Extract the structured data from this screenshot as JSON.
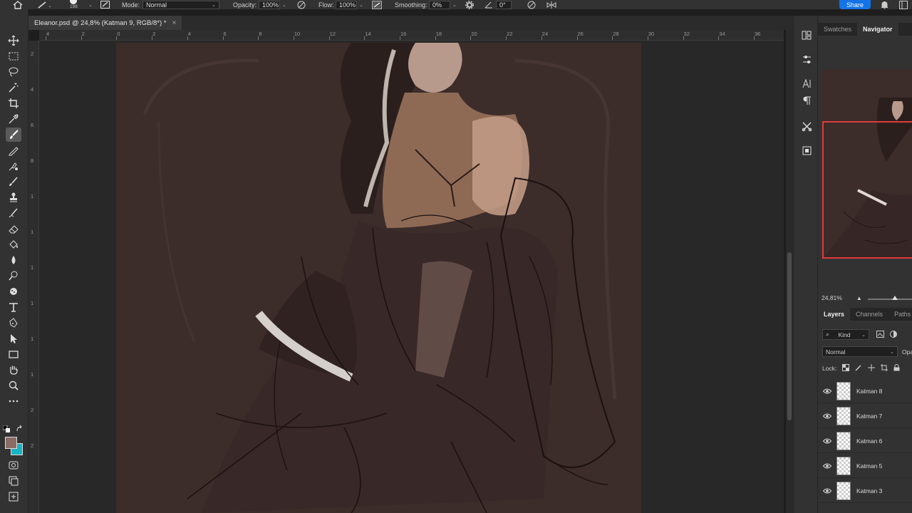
{
  "options_bar": {
    "brush_size": "198",
    "mode_label": "Mode:",
    "mode_value": "Normal",
    "opacity_label": "Opacity:",
    "opacity_value": "100%",
    "flow_label": "Flow:",
    "flow_value": "100%",
    "smoothing_label": "Smoothing:",
    "smoothing_value": "0%",
    "angle_value": "0°",
    "share_label": "Share"
  },
  "document_tab": {
    "title": "Eleanor.psd @ 24,8% (Katman 9, RGB/8*) *",
    "close": "×"
  },
  "rulers": {
    "horizontal": [
      "4",
      "2",
      "0",
      "2",
      "4",
      "6",
      "8",
      "10",
      "12",
      "14",
      "16",
      "18",
      "20",
      "22",
      "24",
      "26",
      "28",
      "30",
      "32",
      "34",
      "36"
    ],
    "vertical": [
      "2",
      "4",
      "6",
      "8",
      "1",
      "1",
      "1",
      "1",
      "1",
      "1",
      "2",
      "2"
    ]
  },
  "panels": {
    "top_tabs": [
      "Swatches",
      "Navigator"
    ],
    "active_top_tab": "Navigator",
    "navigator_zoom": "24,81%",
    "layers_tabs": [
      "Layers",
      "Channels",
      "Paths"
    ],
    "active_layers_tab": "Layers",
    "filter_label": "Kind",
    "blend_mode": "Normal",
    "opacity_abbrev": "Opa",
    "lock_label": "Lock:",
    "layers": [
      {
        "name": "Katman 8"
      },
      {
        "name": "Katman 7"
      },
      {
        "name": "Katman 6"
      },
      {
        "name": "Katman 5"
      },
      {
        "name": "Katman 3"
      }
    ]
  },
  "colors": {
    "foreground": "#8b6c66",
    "background": "#19b3c6",
    "accent": "#1473e6",
    "canvas": "#3c2c2a",
    "navigator_frame": "#e03b3b"
  },
  "tools": [
    "move-icon",
    "marquee-icon",
    "lasso-icon",
    "magic-wand-icon",
    "crop-icon",
    "eyedropper-icon",
    "brush-icon",
    "pencil-icon",
    "clone-stamp-icon",
    "history-brush-icon",
    "stamp-icon",
    "mixer-brush-icon",
    "eraser-icon",
    "paint-bucket-icon",
    "blur-icon",
    "dodge-icon",
    "sponge-icon",
    "smudge-icon",
    "type-icon",
    "pen-icon",
    "path-select-icon",
    "rectangle-icon",
    "hand-icon",
    "zoom-icon",
    "more-icon"
  ]
}
